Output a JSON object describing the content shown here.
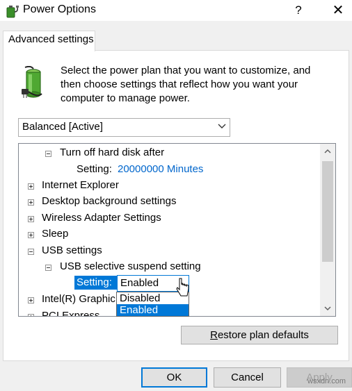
{
  "window": {
    "title": "Power Options",
    "help": "?",
    "close": "✕"
  },
  "tab": {
    "label": "Advanced settings"
  },
  "description": "Select the power plan that you want to customize, and then choose settings that reflect how you want your computer to manage power.",
  "plan_select": {
    "value": "Balanced [Active]"
  },
  "tree": {
    "turn_off_hard_disk": "Turn off hard disk after",
    "hard_disk_setting_label": "Setting:",
    "hard_disk_setting_value": "20000000 Minutes",
    "internet_explorer": "Internet Explorer",
    "desktop_background": "Desktop background settings",
    "wireless_adapter": "Wireless Adapter Settings",
    "sleep": "Sleep",
    "usb_settings": "USB settings",
    "usb_selective_suspend": "USB selective suspend setting",
    "usb_setting_label": "Setting:",
    "usb_setting_value": "Enabled",
    "intel_graphics": "Intel(R) Graphic",
    "pci_express": "PCI Express"
  },
  "dropdown_options": [
    "Disabled",
    "Enabled"
  ],
  "buttons": {
    "restore": "Restore plan defaults",
    "ok": "OK",
    "cancel": "Cancel",
    "apply": "Apply"
  },
  "watermark": "wsxdn.com",
  "colors": {
    "accent": "#0078d7",
    "link_blue": "#0066cc",
    "dialog_bg": "#f0f0f0"
  }
}
